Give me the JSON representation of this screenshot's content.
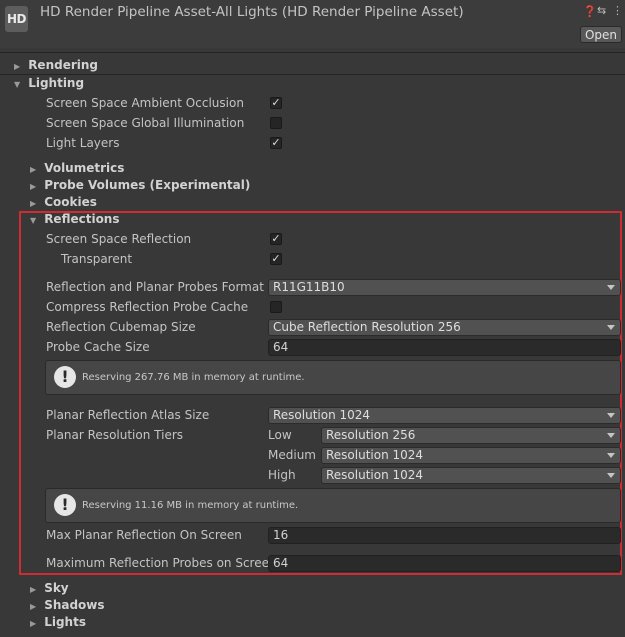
{
  "window": {
    "logo_text": "HD",
    "title": "HD Render Pipeline Asset-All Lights (HD Render Pipeline Asset)",
    "open_label": "Open"
  },
  "sections": {
    "rendering": "Rendering",
    "lighting": "Lighting",
    "volumetrics": "Volumetrics",
    "probe_volumes": "Probe Volumes (Experimental)",
    "cookies": "Cookies",
    "reflections": "Reflections",
    "sky": "Sky",
    "shadows": "Shadows",
    "lights": "Lights"
  },
  "lighting": {
    "ssao": {
      "label": "Screen Space Ambient Occlusion",
      "checked": true
    },
    "ssgi": {
      "label": "Screen Space Global Illumination",
      "checked": false
    },
    "light_layers": {
      "label": "Light Layers",
      "checked": true
    }
  },
  "reflections": {
    "ssr": {
      "label": "Screen Space Reflection",
      "checked": true
    },
    "transparent": {
      "label": "Transparent",
      "checked": true
    },
    "probes_format": {
      "label": "Reflection and Planar Probes Format",
      "value": "R11G11B10"
    },
    "compress_cache": {
      "label": "Compress Reflection Probe Cache",
      "checked": false
    },
    "cubemap_size": {
      "label": "Reflection Cubemap Size",
      "value": "Cube Reflection Resolution 256"
    },
    "probe_cache_size": {
      "label": "Probe Cache Size",
      "value": "64"
    },
    "probe_cache_help": "Reserving 267.76 MB in memory at runtime.",
    "planar_atlas_size": {
      "label": "Planar Reflection Atlas Size",
      "value": "Resolution 1024"
    },
    "planar_tiers": {
      "label": "Planar Resolution Tiers",
      "low": {
        "label": "Low",
        "value": "Resolution 256"
      },
      "medium": {
        "label": "Medium",
        "value": "Resolution 1024"
      },
      "high": {
        "label": "High",
        "value": "Resolution 1024"
      }
    },
    "planar_help": "Reserving 11.16 MB in memory at runtime.",
    "max_planar": {
      "label": "Max Planar Reflection On Screen",
      "value": "16"
    },
    "max_probes": {
      "label": "Maximum Reflection Probes on Screen",
      "value": "64"
    }
  },
  "icons": {
    "checkmark": "✓",
    "warning": "!",
    "collapsed": "▶",
    "expanded": "▼"
  },
  "colors": {
    "background": "#383838",
    "highlight": "#cf2b33"
  }
}
